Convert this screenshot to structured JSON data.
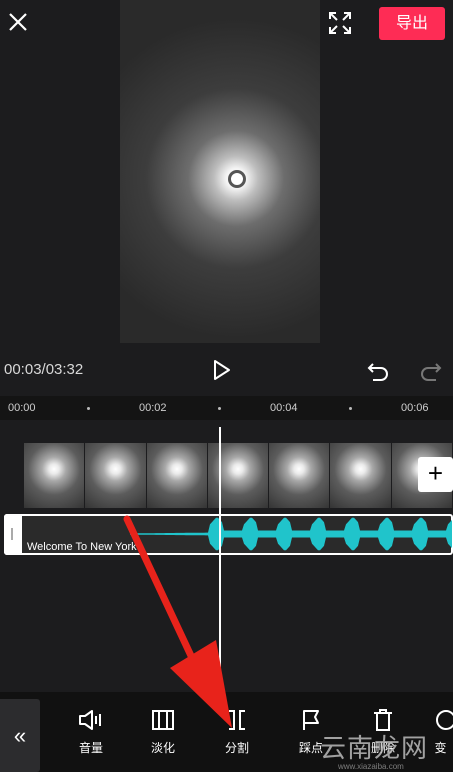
{
  "topbar": {
    "export_label": "导出"
  },
  "player": {
    "time_readout": "00:03/03:32"
  },
  "ruler": {
    "ticks": [
      "00:00",
      "00:02",
      "00:04",
      "00:06"
    ]
  },
  "audio": {
    "title": "Welcome To New York",
    "waveform_color": "#20c4cb"
  },
  "toolbar": {
    "items": [
      {
        "label": "音量",
        "icon": "volume-icon"
      },
      {
        "label": "淡化",
        "icon": "fade-icon"
      },
      {
        "label": "分割",
        "icon": "split-icon"
      },
      {
        "label": "踩点",
        "icon": "beat-flag-icon"
      },
      {
        "label": "删除",
        "icon": "delete-icon"
      },
      {
        "label": "变",
        "icon": "speed-icon"
      }
    ]
  },
  "overlay": {
    "arrow_color": "#e8231b",
    "watermark": "云南龙网",
    "watermark_url": "www.xiazaiba.com"
  },
  "colors": {
    "accent": "#fe2c55"
  }
}
